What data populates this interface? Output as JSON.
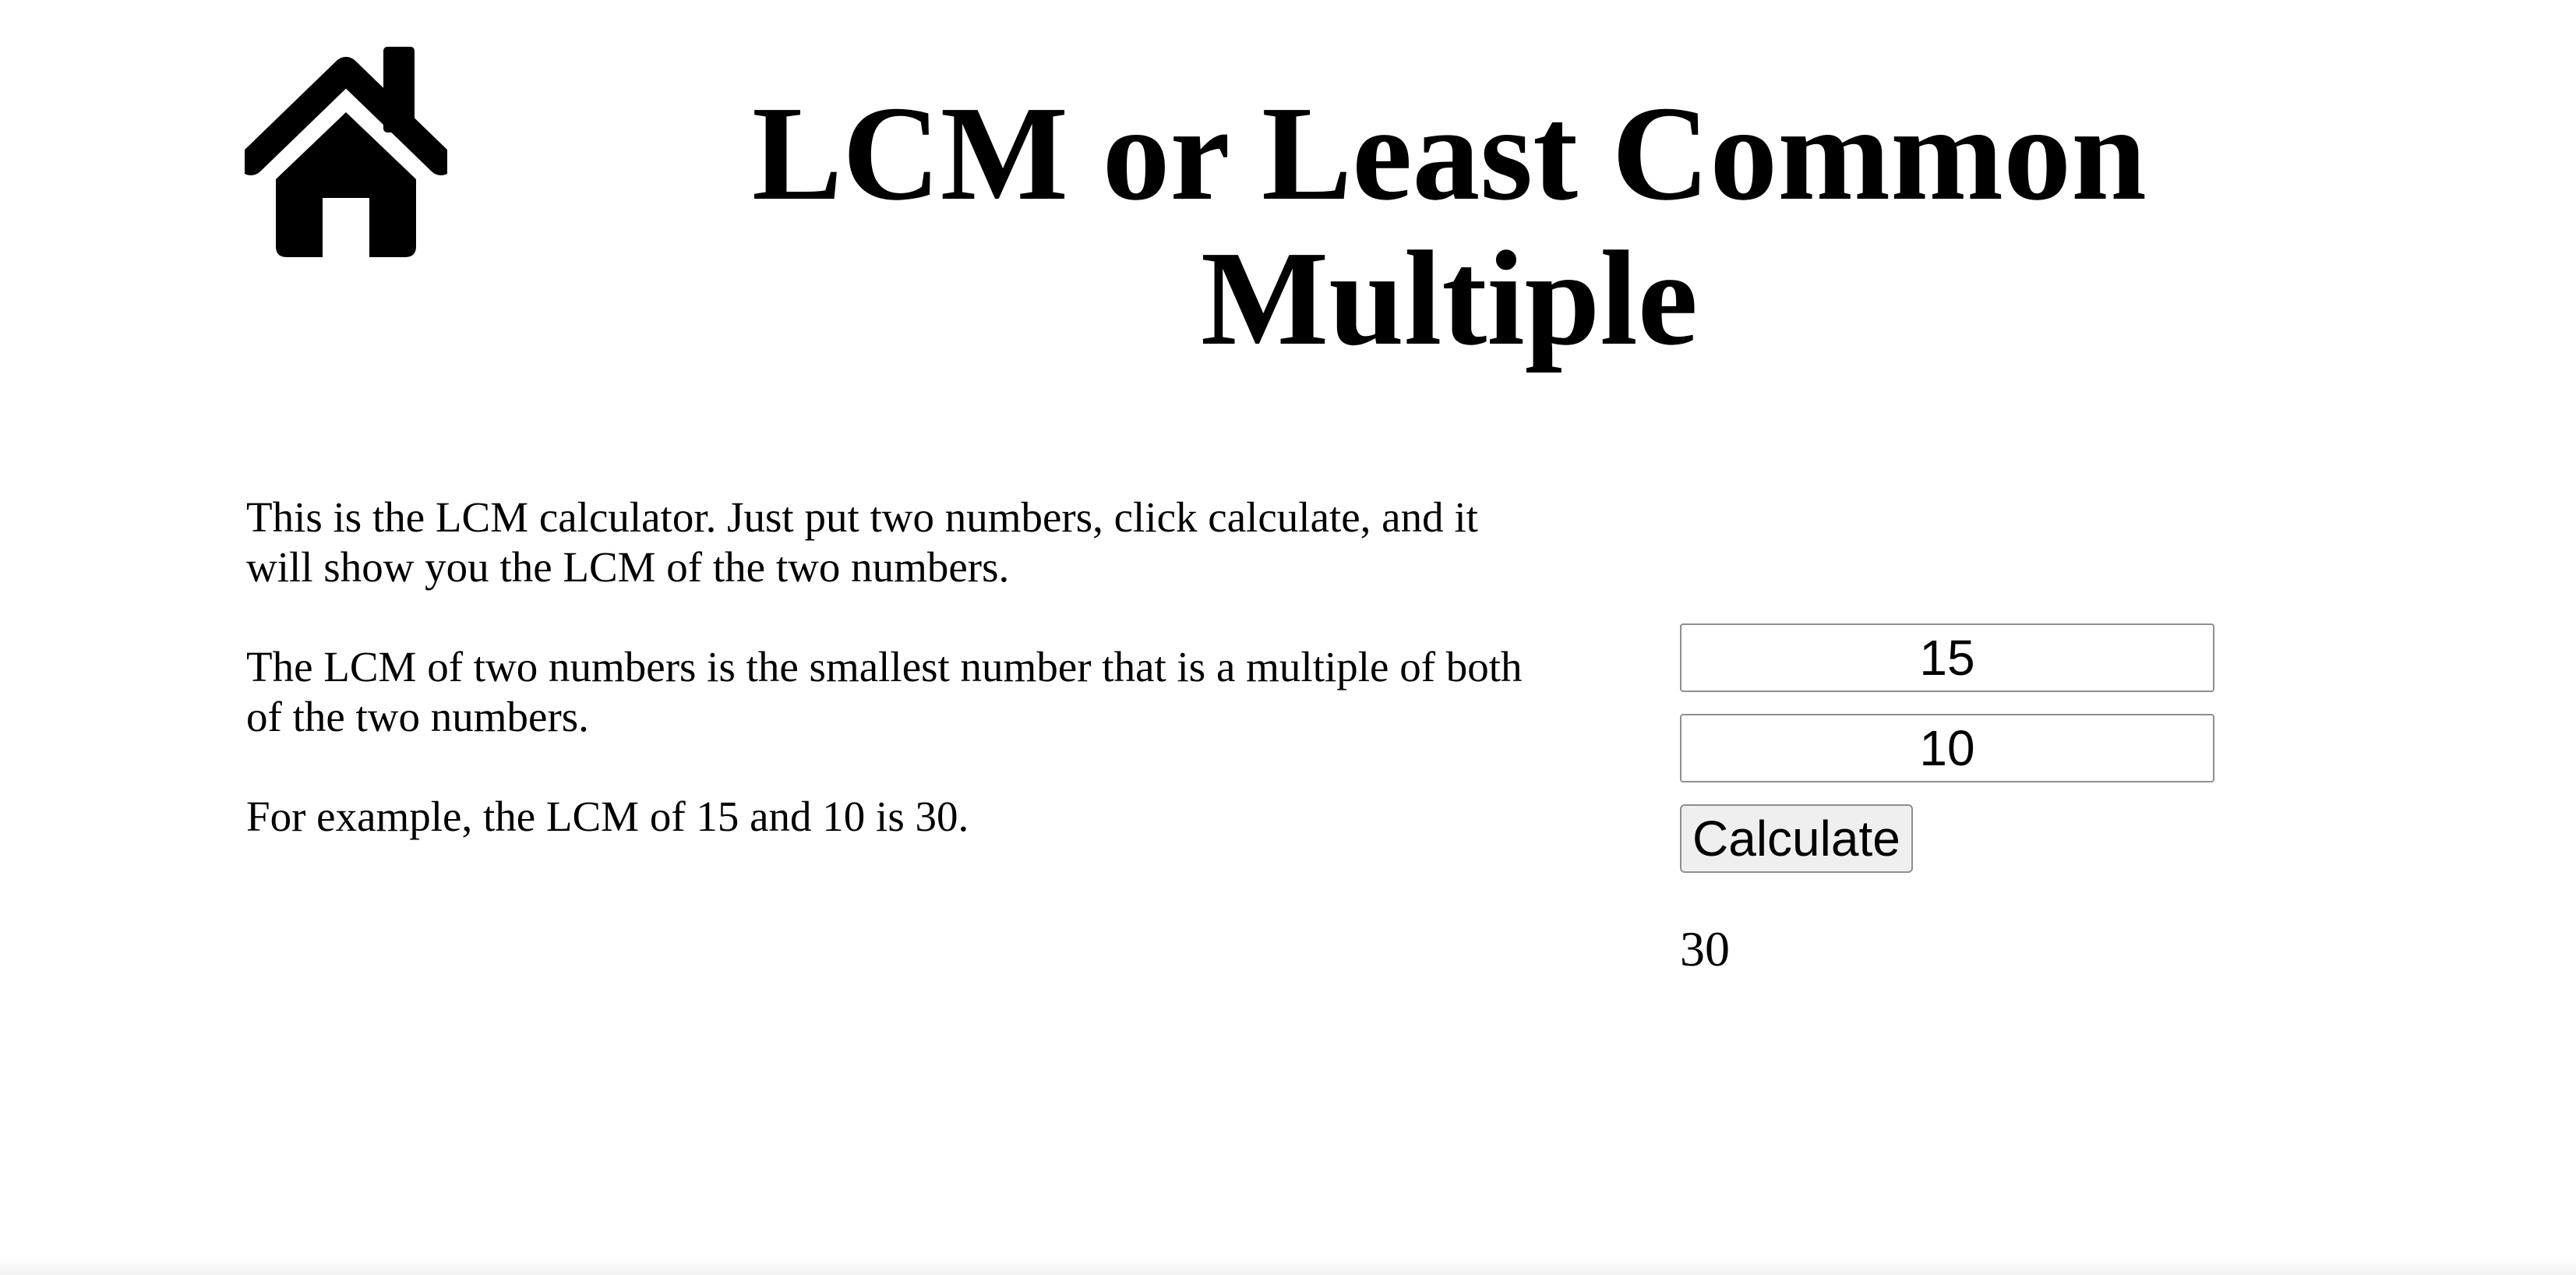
{
  "header": {
    "home_icon": "house-icon",
    "title": "LCM or Least Common Multiple"
  },
  "intro": {
    "paragraphs": [
      "This is the LCM calculator. Just put two numbers, click calculate, and it will show you the LCM of the two numbers.",
      "The LCM of two numbers is the smallest number that is a multiple of both of the two numbers.",
      "For example, the LCM of 15 and 10 is 30."
    ]
  },
  "calculator": {
    "first_number": "15",
    "second_number": "10",
    "button_label": "Calculate",
    "result": "30"
  }
}
